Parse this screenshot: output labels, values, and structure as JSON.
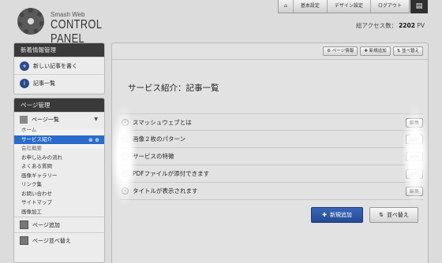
{
  "header": {
    "logo_small": "Smash Web",
    "logo_big": "CONTROL PANEL",
    "nav": [
      {
        "icon": "home-icon",
        "glyph": "⌂"
      },
      {
        "label": "基本設定"
      },
      {
        "label": "デザイン設定"
      },
      {
        "label": "ログアウト"
      }
    ],
    "menu_glyph": "▤",
    "access_label": "総アクセス数：",
    "access_count": "2202",
    "access_unit": "PV"
  },
  "sidebar": {
    "news_title": "新着情報管理",
    "news_items": [
      {
        "label": "新しい記事を書く",
        "icon": "new-post-icon",
        "glyph": "+"
      },
      {
        "label": "記事一覧",
        "icon": "info-icon",
        "glyph": "i"
      }
    ],
    "page_title": "ページ管理",
    "page_list_label": "ページ一覧",
    "pages": [
      "ホーム",
      "サービス紹介",
      "会社概要",
      "お申し込みの流れ",
      "よくある質問",
      "画像ギャラリー",
      "リンク集",
      "お問い合わせ",
      "サイトマップ",
      "画像加工"
    ],
    "active_page_index": 1,
    "add_page_label": "ページ追加",
    "sort_pages_label": "ページ並べ替え"
  },
  "main": {
    "tools": [
      "ページ情報",
      "新規追加",
      "並べ替え"
    ],
    "title": "サービス紹介：記事一覧",
    "articles": [
      "スマッシュウェブとは",
      "画像２枚のパターン",
      "サービスの特徴",
      "PDFファイルが添付できます",
      "タイトルが表示されます"
    ],
    "edit_label": "編集",
    "new_button": "新規追加",
    "sort_button": "並べ替え"
  },
  "colors": {
    "accent": "#2a6cc9",
    "dark_header": "#3a3a3a",
    "primary_button": "#2b55a8"
  }
}
